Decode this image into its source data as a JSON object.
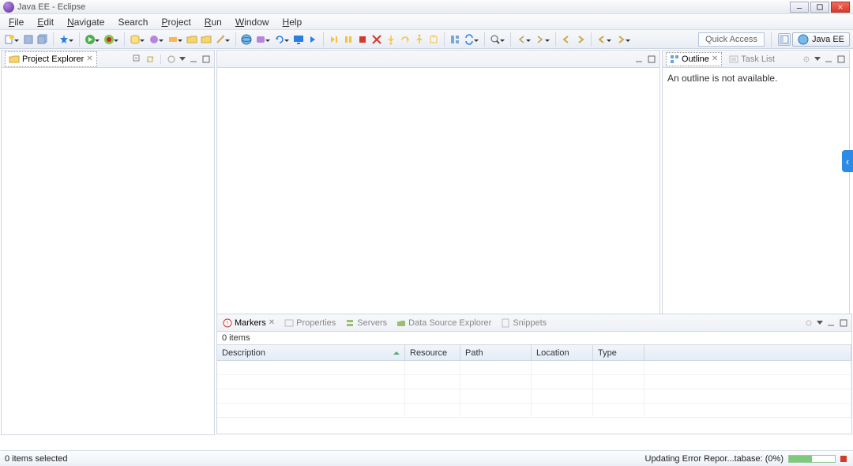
{
  "window": {
    "title": "Java EE - Eclipse",
    "quick_access": "Quick Access",
    "perspective_label": "Java EE"
  },
  "menubar": {
    "items": [
      {
        "label": "File",
        "u": "F",
        "rest": "ile"
      },
      {
        "label": "Edit",
        "u": "E",
        "rest": "dit"
      },
      {
        "label": "Navigate",
        "u": "N",
        "rest": "avigate"
      },
      {
        "label": "Search",
        "u": "",
        "rest": "Search"
      },
      {
        "label": "Project",
        "u": "P",
        "rest": "roject"
      },
      {
        "label": "Run",
        "u": "R",
        "rest": "un"
      },
      {
        "label": "Window",
        "u": "W",
        "rest": "indow"
      },
      {
        "label": "Help",
        "u": "H",
        "rest": "elp"
      }
    ]
  },
  "views": {
    "project_explorer": {
      "label": "Project Explorer"
    },
    "outline": {
      "label": "Outline",
      "body": "An outline is not available."
    },
    "task_list": {
      "label": "Task List"
    }
  },
  "bottom": {
    "tabs": [
      {
        "label": "Markers",
        "active": true
      },
      {
        "label": "Properties"
      },
      {
        "label": "Servers"
      },
      {
        "label": "Data Source Explorer"
      },
      {
        "label": "Snippets"
      }
    ],
    "items_count": "0 items",
    "columns": [
      "Description",
      "Resource",
      "Path",
      "Location",
      "Type"
    ]
  },
  "statusbar": {
    "left": "0 items selected",
    "right": "Updating Error Repor...tabase: (0%)"
  }
}
